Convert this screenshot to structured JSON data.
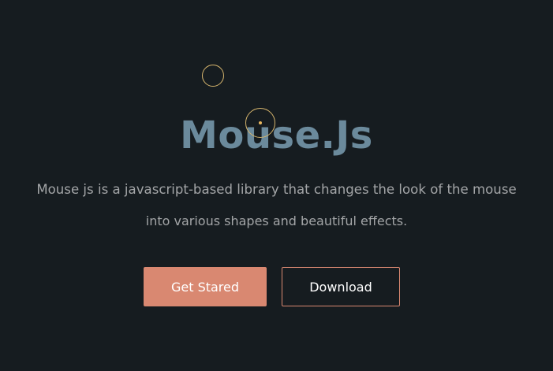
{
  "hero": {
    "title": "Mouse.Js",
    "description_line1": "Mouse js is a javascript-based library that changes the look of the mouse",
    "description_line2": "into various shapes and beautiful effects."
  },
  "buttons": {
    "primary_label": "Get Stared",
    "secondary_label": "Download"
  },
  "colors": {
    "background": "#161c20",
    "title": "#6b8a9c",
    "accent": "#d98871",
    "cursor": "#d6b56d"
  },
  "icons": {
    "cursor_follower": "cursor-ring-icon",
    "cursor_pointer": "cursor-ring-icon",
    "cursor_center": "cursor-dot-icon"
  }
}
